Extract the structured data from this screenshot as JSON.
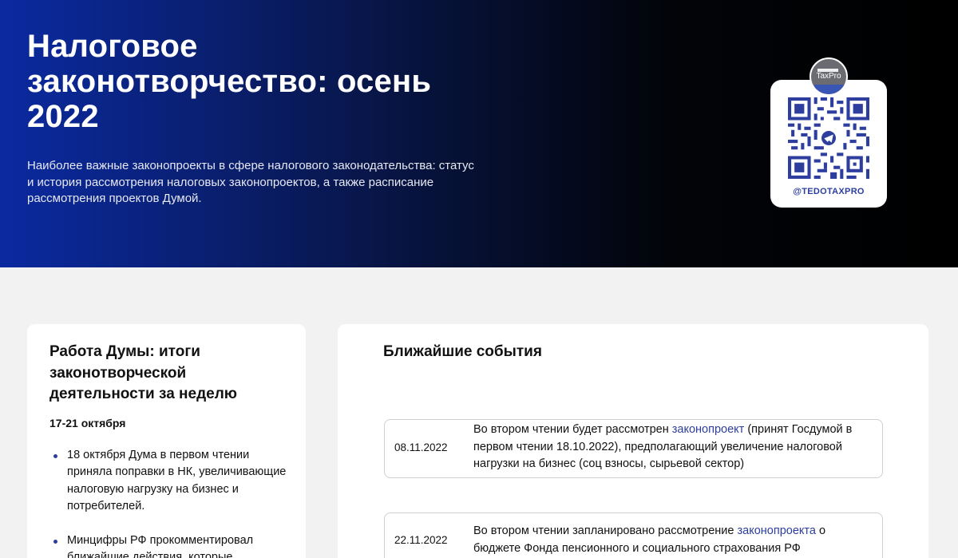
{
  "hero": {
    "title": "Налоговое законотворчество: осень 2022",
    "subtitle": "Наиболее важные законопроекты в сфере налогового законодательства: статус и история рассмотрения налоговых законопроектов, а также расписание рассмотрения проектов Думой."
  },
  "qr": {
    "logo_text": "TaxPro",
    "handle": "@TEDOTAXPRO",
    "icon": "telegram-icon"
  },
  "left_card": {
    "title": "Работа Думы: итоги законотворческой деятельности за неделю",
    "date_range": "17-21 октября",
    "items": [
      "18 октября Дума в первом чтении приняла поправки в НК, увеличивающие налоговую нагрузку на бизнес и потребителей.",
      "Минцифры РФ прокомментировал ближайшие действия, которые"
    ]
  },
  "right_card": {
    "title": "Ближайшие события",
    "events": [
      {
        "date": "08.11.2022",
        "text_before": "Во втором чтении будет рассмотрен ",
        "link": "законопроект",
        "text_after": " (принят Госдумой в первом чтении 18.10.2022), предполагающий увеличение налоговой нагрузки на бизнес (соц взносы, сырьевой сектор)"
      },
      {
        "date": "22.11.2022",
        "text_before": "Во втором чтении запланировано рассмотрение ",
        "link": "законопроекта",
        "text_after": " о бюджете Фонда пенсионного и социального страхования РФ"
      }
    ]
  },
  "colors": {
    "accent": "#2d3e9e",
    "hero_start": "#0b2aa0",
    "hero_end": "#000000",
    "page_bg": "#f2f2f3"
  }
}
